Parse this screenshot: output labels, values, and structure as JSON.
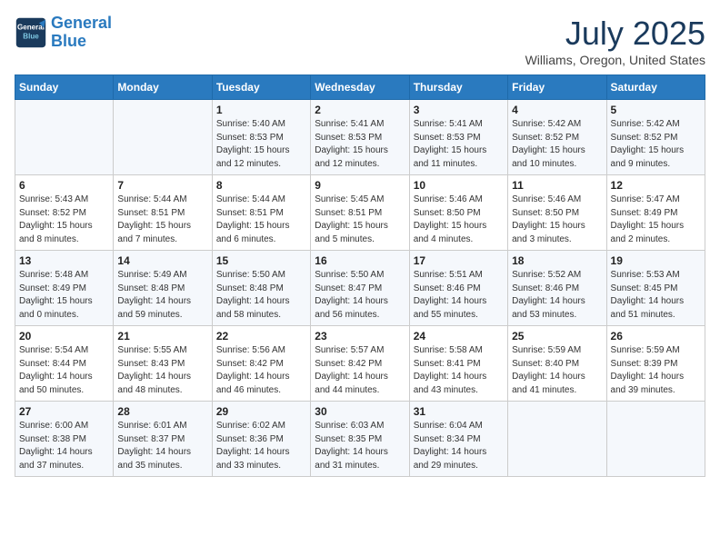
{
  "header": {
    "logo_line1": "General",
    "logo_line2": "Blue",
    "month": "July 2025",
    "location": "Williams, Oregon, United States"
  },
  "days_of_week": [
    "Sunday",
    "Monday",
    "Tuesday",
    "Wednesday",
    "Thursday",
    "Friday",
    "Saturday"
  ],
  "weeks": [
    [
      {
        "day": "",
        "info": ""
      },
      {
        "day": "",
        "info": ""
      },
      {
        "day": "1",
        "info": "Sunrise: 5:40 AM\nSunset: 8:53 PM\nDaylight: 15 hours and 12 minutes."
      },
      {
        "day": "2",
        "info": "Sunrise: 5:41 AM\nSunset: 8:53 PM\nDaylight: 15 hours and 12 minutes."
      },
      {
        "day": "3",
        "info": "Sunrise: 5:41 AM\nSunset: 8:53 PM\nDaylight: 15 hours and 11 minutes."
      },
      {
        "day": "4",
        "info": "Sunrise: 5:42 AM\nSunset: 8:52 PM\nDaylight: 15 hours and 10 minutes."
      },
      {
        "day": "5",
        "info": "Sunrise: 5:42 AM\nSunset: 8:52 PM\nDaylight: 15 hours and 9 minutes."
      }
    ],
    [
      {
        "day": "6",
        "info": "Sunrise: 5:43 AM\nSunset: 8:52 PM\nDaylight: 15 hours and 8 minutes."
      },
      {
        "day": "7",
        "info": "Sunrise: 5:44 AM\nSunset: 8:51 PM\nDaylight: 15 hours and 7 minutes."
      },
      {
        "day": "8",
        "info": "Sunrise: 5:44 AM\nSunset: 8:51 PM\nDaylight: 15 hours and 6 minutes."
      },
      {
        "day": "9",
        "info": "Sunrise: 5:45 AM\nSunset: 8:51 PM\nDaylight: 15 hours and 5 minutes."
      },
      {
        "day": "10",
        "info": "Sunrise: 5:46 AM\nSunset: 8:50 PM\nDaylight: 15 hours and 4 minutes."
      },
      {
        "day": "11",
        "info": "Sunrise: 5:46 AM\nSunset: 8:50 PM\nDaylight: 15 hours and 3 minutes."
      },
      {
        "day": "12",
        "info": "Sunrise: 5:47 AM\nSunset: 8:49 PM\nDaylight: 15 hours and 2 minutes."
      }
    ],
    [
      {
        "day": "13",
        "info": "Sunrise: 5:48 AM\nSunset: 8:49 PM\nDaylight: 15 hours and 0 minutes."
      },
      {
        "day": "14",
        "info": "Sunrise: 5:49 AM\nSunset: 8:48 PM\nDaylight: 14 hours and 59 minutes."
      },
      {
        "day": "15",
        "info": "Sunrise: 5:50 AM\nSunset: 8:48 PM\nDaylight: 14 hours and 58 minutes."
      },
      {
        "day": "16",
        "info": "Sunrise: 5:50 AM\nSunset: 8:47 PM\nDaylight: 14 hours and 56 minutes."
      },
      {
        "day": "17",
        "info": "Sunrise: 5:51 AM\nSunset: 8:46 PM\nDaylight: 14 hours and 55 minutes."
      },
      {
        "day": "18",
        "info": "Sunrise: 5:52 AM\nSunset: 8:46 PM\nDaylight: 14 hours and 53 minutes."
      },
      {
        "day": "19",
        "info": "Sunrise: 5:53 AM\nSunset: 8:45 PM\nDaylight: 14 hours and 51 minutes."
      }
    ],
    [
      {
        "day": "20",
        "info": "Sunrise: 5:54 AM\nSunset: 8:44 PM\nDaylight: 14 hours and 50 minutes."
      },
      {
        "day": "21",
        "info": "Sunrise: 5:55 AM\nSunset: 8:43 PM\nDaylight: 14 hours and 48 minutes."
      },
      {
        "day": "22",
        "info": "Sunrise: 5:56 AM\nSunset: 8:42 PM\nDaylight: 14 hours and 46 minutes."
      },
      {
        "day": "23",
        "info": "Sunrise: 5:57 AM\nSunset: 8:42 PM\nDaylight: 14 hours and 44 minutes."
      },
      {
        "day": "24",
        "info": "Sunrise: 5:58 AM\nSunset: 8:41 PM\nDaylight: 14 hours and 43 minutes."
      },
      {
        "day": "25",
        "info": "Sunrise: 5:59 AM\nSunset: 8:40 PM\nDaylight: 14 hours and 41 minutes."
      },
      {
        "day": "26",
        "info": "Sunrise: 5:59 AM\nSunset: 8:39 PM\nDaylight: 14 hours and 39 minutes."
      }
    ],
    [
      {
        "day": "27",
        "info": "Sunrise: 6:00 AM\nSunset: 8:38 PM\nDaylight: 14 hours and 37 minutes."
      },
      {
        "day": "28",
        "info": "Sunrise: 6:01 AM\nSunset: 8:37 PM\nDaylight: 14 hours and 35 minutes."
      },
      {
        "day": "29",
        "info": "Sunrise: 6:02 AM\nSunset: 8:36 PM\nDaylight: 14 hours and 33 minutes."
      },
      {
        "day": "30",
        "info": "Sunrise: 6:03 AM\nSunset: 8:35 PM\nDaylight: 14 hours and 31 minutes."
      },
      {
        "day": "31",
        "info": "Sunrise: 6:04 AM\nSunset: 8:34 PM\nDaylight: 14 hours and 29 minutes."
      },
      {
        "day": "",
        "info": ""
      },
      {
        "day": "",
        "info": ""
      }
    ]
  ]
}
